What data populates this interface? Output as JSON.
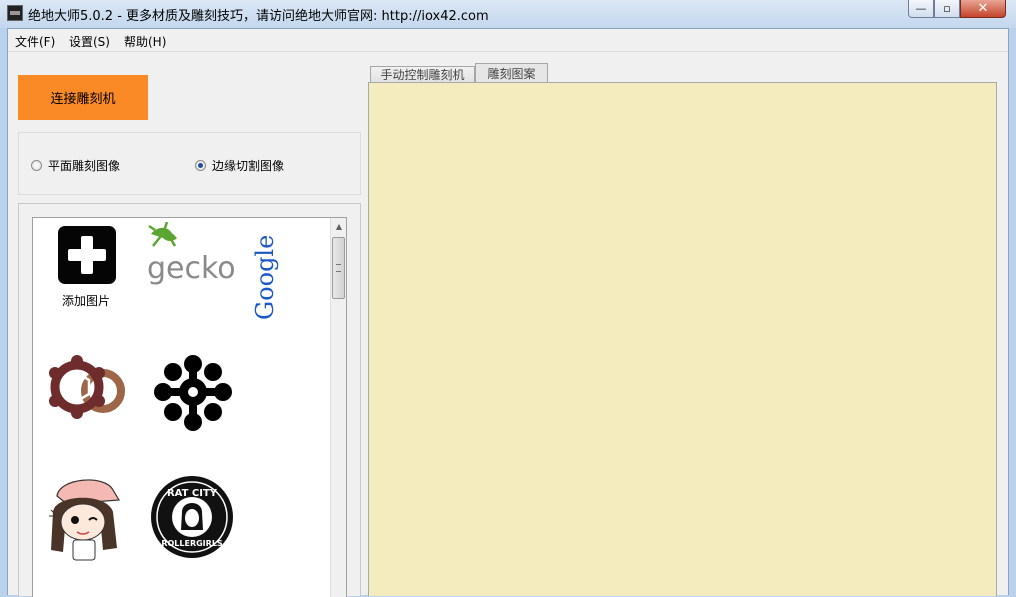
{
  "window": {
    "title": "绝地大师5.0.2 - 更多材质及雕刻技巧，请访问绝地大师官网: http://iox42.com",
    "app_icon": "app-icon",
    "min_icon": "—",
    "max_icon": "▫",
    "close_icon": "✕"
  },
  "menu": {
    "items": [
      {
        "label": "文件(F)"
      },
      {
        "label": "设置(S)"
      },
      {
        "label": "帮助(H)"
      }
    ]
  },
  "controls": {
    "connect_label": "连接雕刻机",
    "mode_options": [
      {
        "label": "平面雕刻图像",
        "checked": false
      },
      {
        "label": "边缘切割图像",
        "checked": true
      }
    ]
  },
  "gallery": {
    "add_label": "添加图片",
    "thumbnails": [
      "add-image-icon",
      "gecko-logo",
      "google-logo",
      "gear-logo",
      "flower-pattern",
      "cartoon-girl",
      "rat-city-rollergirls-logo"
    ],
    "gecko_text": "gecko",
    "google_text": "Google",
    "rat_city_top": "RAT CITY",
    "rat_city_bottom": "ROLLERGIRLS"
  },
  "tabs": [
    {
      "label": "手动控制雕刻机",
      "active": false
    },
    {
      "label": "雕刻图案",
      "active": true
    }
  ],
  "colors": {
    "connect_button": "#fa8a26",
    "canvas_background": "#f4ebbf"
  }
}
